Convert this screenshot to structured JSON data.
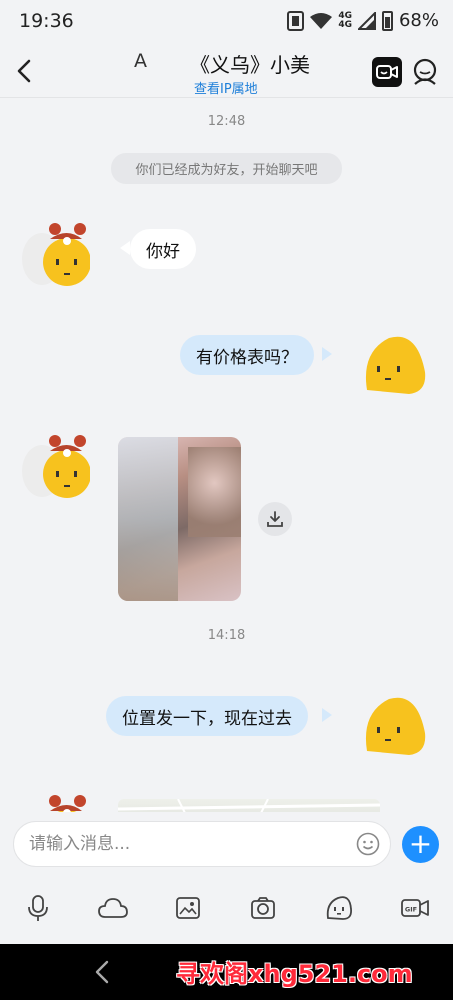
{
  "status_bar": {
    "time": "19:36",
    "network_top": "4G",
    "network_bottom": "4G",
    "battery": "68%"
  },
  "header": {
    "prefix": "A",
    "title": "《义乌》小美",
    "subtitle": "查看IP属地",
    "back_icon": "chevron-left-icon",
    "video_icon": "video-call-icon",
    "profile_icon": "profile-icon"
  },
  "chat": {
    "timestamps": [
      "12:48",
      "14:18"
    ],
    "system_notice": "你们已经成为好友，开始聊天吧",
    "messages": [
      {
        "side": "in",
        "type": "text",
        "text": "你好"
      },
      {
        "side": "out",
        "type": "text",
        "text": "有价格表吗？"
      },
      {
        "side": "in",
        "type": "image",
        "text": ""
      },
      {
        "side": "out",
        "type": "text",
        "text": "位置发一下，现在过去"
      },
      {
        "side": "in",
        "type": "location",
        "text": ""
      }
    ]
  },
  "input": {
    "placeholder": "请输入消息...",
    "plus_label": "+"
  },
  "toolbar": {
    "icons": [
      "microphone-icon",
      "cloud-icon",
      "image-icon",
      "camera-icon",
      "sticker-icon",
      "gif-icon"
    ]
  },
  "watermark": "寻欢阁xhg521.com",
  "colors": {
    "accent": "#1e90ff",
    "outgoing_bubble": "#d5e9fb",
    "incoming_bubble": "#ffffff",
    "background": "#f2f3f5",
    "link": "#1e7fd9",
    "watermark": "#ff2a3a"
  }
}
